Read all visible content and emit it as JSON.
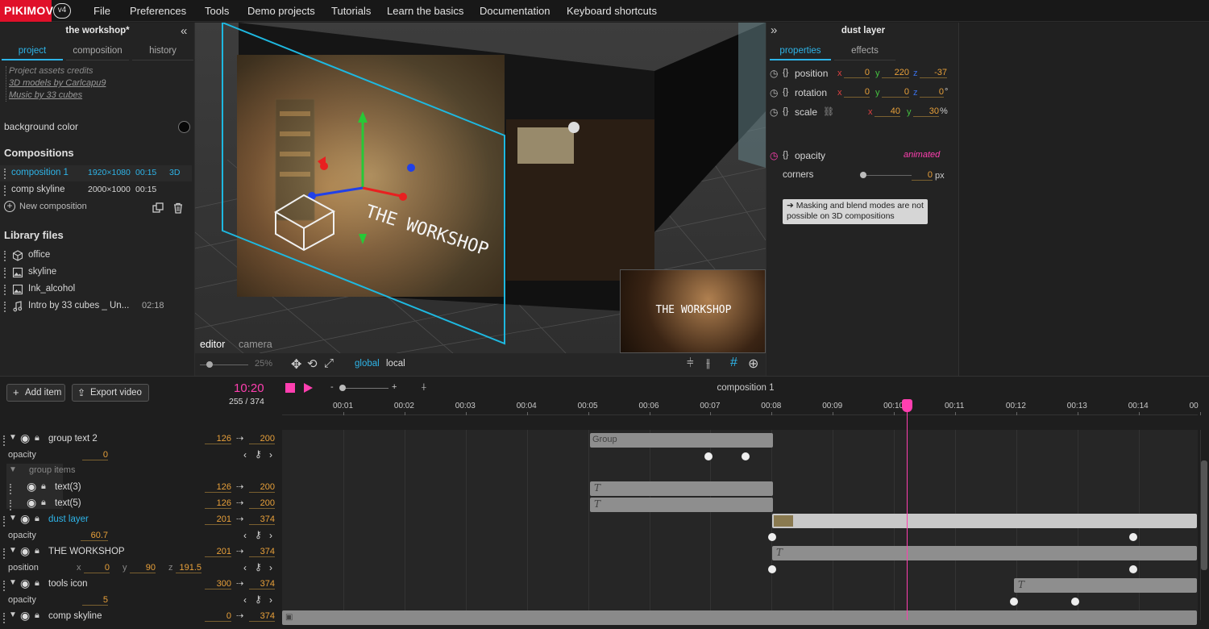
{
  "app": {
    "logo": "PIKIMOV",
    "version": "v4"
  },
  "menu": [
    "File",
    "Preferences",
    "Tools",
    "Demo projects",
    "Tutorials",
    "Learn the basics",
    "Documentation",
    "Keyboard shortcuts"
  ],
  "left": {
    "title": "the workshop*",
    "tabs": [
      "project",
      "composition",
      "history"
    ],
    "credits": [
      "Project assets credits",
      "3D models by Carlcapu9",
      "Music by 33 cubes"
    ],
    "bg_color_label": "background color",
    "compositions_title": "Compositions",
    "compositions": [
      {
        "name": "composition 1",
        "size": "1920×1080",
        "duration": "00:15",
        "mode": "3D"
      },
      {
        "name": "comp skyline",
        "size": "2000×1000",
        "duration": "00:15",
        "mode": ""
      }
    ],
    "new_composition": "New composition",
    "library_title": "Library files",
    "library": [
      {
        "name": "office",
        "icon": "cube-icon",
        "duration": ""
      },
      {
        "name": "skyline",
        "icon": "image-icon",
        "duration": ""
      },
      {
        "name": "Ink_alcohol",
        "icon": "image-icon",
        "duration": ""
      },
      {
        "name": "Intro by 33 cubes _ Un...",
        "icon": "music-icon",
        "duration": "02:18"
      }
    ]
  },
  "viewport": {
    "scene_text": "THE WORKSHOP",
    "preview_text": "THE WORKSHOP",
    "tabs": [
      "editor",
      "camera"
    ],
    "zoom": "25%",
    "space_global": "global",
    "space_local": "local"
  },
  "right": {
    "title": "dust layer",
    "tabs": [
      "properties",
      "effects"
    ],
    "position": {
      "label": "position",
      "x": "0",
      "y": "220",
      "z": "-37"
    },
    "rotation": {
      "label": "rotation",
      "x": "0",
      "y": "0",
      "z": "0",
      "unit": "°"
    },
    "scale": {
      "label": "scale",
      "x": "40",
      "y": "30",
      "unit": "%"
    },
    "opacity": {
      "label": "opacity",
      "status": "animated"
    },
    "corners": {
      "label": "corners",
      "value": "0",
      "unit": "px"
    },
    "notice": "➔ Masking and blend modes are not possible on 3D compositions"
  },
  "timeline": {
    "add_item": "Add item",
    "export_video": "Export video",
    "time": "10:20",
    "frames": "255 / 374",
    "comp_name": "composition 1",
    "ruler": [
      "00:01",
      "00:02",
      "00:03",
      "00:04",
      "00:05",
      "00:06",
      "00:07",
      "00:08",
      "00:09",
      "00:10",
      "00:11",
      "00:12",
      "00:13",
      "00:14",
      "00"
    ],
    "layers": {
      "group_text_2": {
        "name": "group text 2",
        "start": "126",
        "end": "200",
        "clip": "Group"
      },
      "gt_opacity": {
        "label": "opacity",
        "value": "0"
      },
      "group_items": {
        "label": "group items"
      },
      "text3": {
        "name": "text(3)",
        "start": "126",
        "end": "200"
      },
      "text5": {
        "name": "text(5)",
        "start": "126",
        "end": "200"
      },
      "dust": {
        "name": "dust layer",
        "start": "201",
        "end": "374"
      },
      "dust_opacity": {
        "label": "opacity",
        "value": "60.7"
      },
      "workshop": {
        "name": "THE WORKSHOP",
        "start": "201",
        "end": "374"
      },
      "ws_position": {
        "label": "position",
        "x": "0",
        "y": "90",
        "z": "191.5"
      },
      "tools": {
        "name": "tools icon",
        "start": "300",
        "end": "374"
      },
      "tools_opacity": {
        "label": "opacity",
        "value": "5"
      },
      "skyline": {
        "name": "comp skyline",
        "start": "0",
        "end": "374"
      }
    },
    "clip_text_glyph": "T",
    "playhead_fraction": 0.682
  },
  "colors": {
    "accent": "#2eb4e8",
    "key_color": "#e8a03a",
    "magenta": "#ff3fb0",
    "brand": "#e0102a"
  }
}
